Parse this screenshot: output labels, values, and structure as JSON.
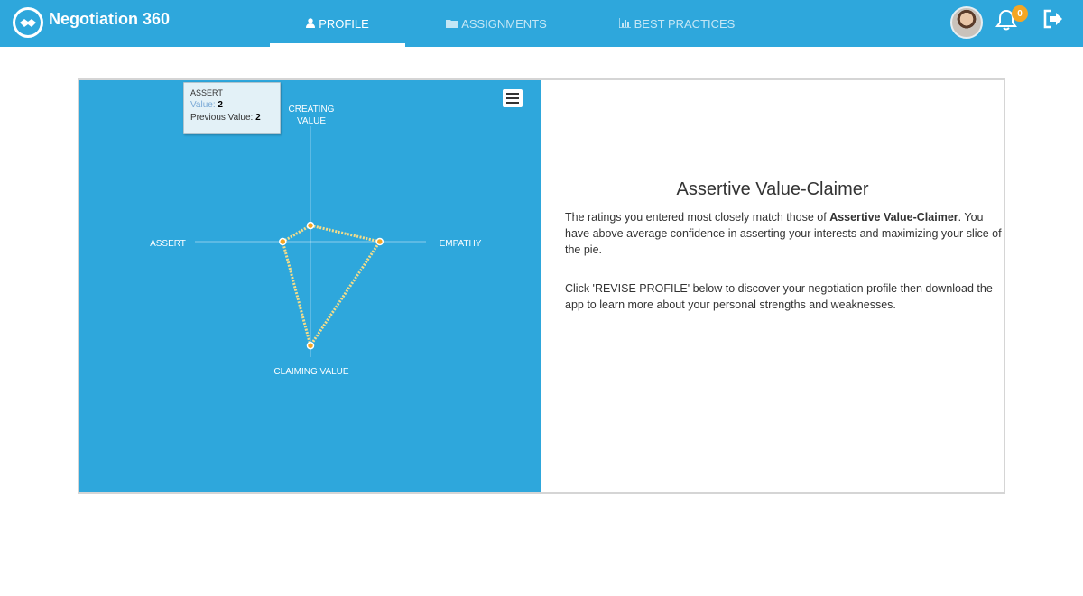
{
  "app": {
    "title": "Negotiation 360",
    "notifications_count": "0"
  },
  "nav": {
    "profile": "PROFILE",
    "assignments": "ASSIGNMENTS",
    "best_practices": "BEST PRACTICES",
    "active": "PROFILE"
  },
  "icons": {
    "logo": "handshake-logo-icon",
    "profile": "user-icon",
    "assignments": "folder-icon",
    "best_practices": "bar-chart-icon",
    "bell": "bell-icon",
    "logout": "sign-out-icon",
    "menu": "hamburger-menu-icon"
  },
  "colors": {
    "accent": "#2ea7dc",
    "badge": "#f5a623",
    "series": "#f3dd8a",
    "point": "#f5a623"
  },
  "chart_data": {
    "type": "radar",
    "axes": [
      "CREATING VALUE",
      "EMPATHY",
      "CLAIMING VALUE",
      "ASSERT"
    ],
    "axis_labels": {
      "top": [
        "CREATING",
        "VALUE"
      ],
      "right": "EMPATHY",
      "bottom": "CLAIMING VALUE",
      "left": "ASSERT"
    },
    "series": [
      {
        "values": [
          0.7,
          3.0,
          4.5,
          1.2
        ]
      }
    ],
    "max": 5,
    "tooltip": {
      "title": "ASSERT",
      "value_label": "Value:",
      "value": "2",
      "previous_label": "Previous Value:",
      "previous": "2"
    }
  },
  "profile": {
    "title": "Assertive Value-Claimer",
    "para1_prefix": "The ratings you entered most closely match those of ",
    "para1_bold": "Assertive Value-Claimer",
    "para1_suffix": ". You have above average confidence in asserting your interests and maximizing your slice of the pie.",
    "para2": "Click 'REVISE PROFILE' below to discover your negotiation profile then download the app to learn more about your personal strengths and weaknesses."
  }
}
